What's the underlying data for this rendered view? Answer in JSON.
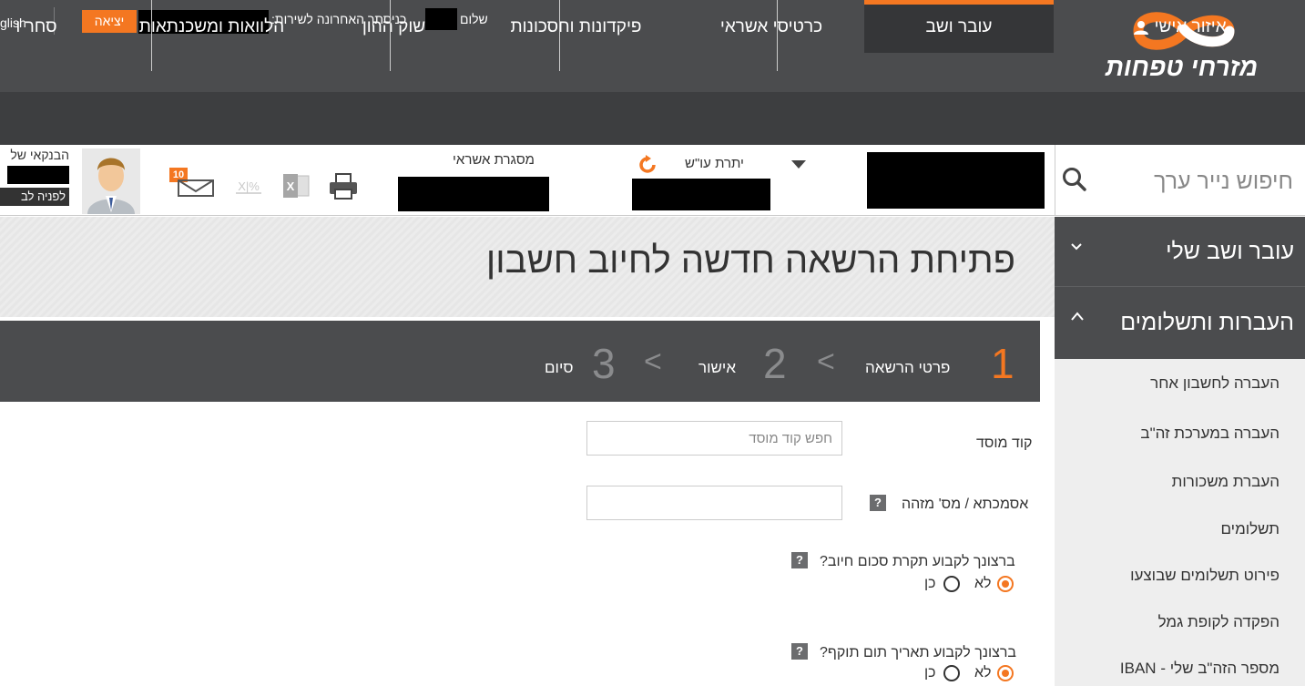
{
  "topbar": {
    "english": "glish",
    "logout": "יציאה",
    "last_login": "כניסתך האחרונה לשירות:",
    "hello": "שלום",
    "logo_text": "מזרחי טפחות"
  },
  "nav": {
    "items": [
      {
        "label": "איזור אישי"
      },
      {
        "label": "עובר ושב"
      },
      {
        "label": "כרטיסי אשראי"
      },
      {
        "label": "פיקדונות וחסכונות"
      },
      {
        "label": "שוק ההון"
      },
      {
        "label": "הלוואות ומשכנתאות"
      },
      {
        "label": "סחר ו"
      }
    ]
  },
  "infobar": {
    "search_placeholder": "חיפוש נייר ערך",
    "balance_label": "יתרת עו\"ש",
    "credit_label": "מסגרת אשראי",
    "banker_label": "הבנקאי של",
    "banker_button": "לפניה לב",
    "mail_count": "10"
  },
  "page": {
    "title": "פתיחת הרשאה חדשה לחיוב חשבון"
  },
  "steps": [
    {
      "num": "1",
      "label": "פרטי הרשאה"
    },
    {
      "num": "2",
      "label": "אישור"
    },
    {
      "num": "3",
      "label": "סיום"
    }
  ],
  "form": {
    "institution_label": "קוד מוסד",
    "institution_placeholder": "חפש קוד מוסד",
    "reference_label": "אסמכתא / מס' מזהה",
    "limit_question": "ברצונך לקבוע תקרת סכום חיוב?",
    "expiry_question": "ברצונך לקבוע תאריך תום תוקף?",
    "no": "לא",
    "yes": "כן",
    "help": "?"
  },
  "sidebar": {
    "section1": "עובר ושב שלי",
    "section2": "העברות ותשלומים",
    "items": [
      {
        "label": "העברה לחשבון אחר"
      },
      {
        "label": "העברה במערכת זה\"ב"
      },
      {
        "label": "העברת משכורות"
      },
      {
        "label": "תשלומים"
      },
      {
        "label": "פירוט תשלומים שבוצעו"
      },
      {
        "label": "הפקדה לקופת גמל"
      },
      {
        "label": "מספר הזה\"ב שלי - IBAN"
      }
    ]
  },
  "colors": {
    "accent": "#f47721",
    "topbar": "#4b4c4e",
    "nav": "#3d3e40"
  }
}
